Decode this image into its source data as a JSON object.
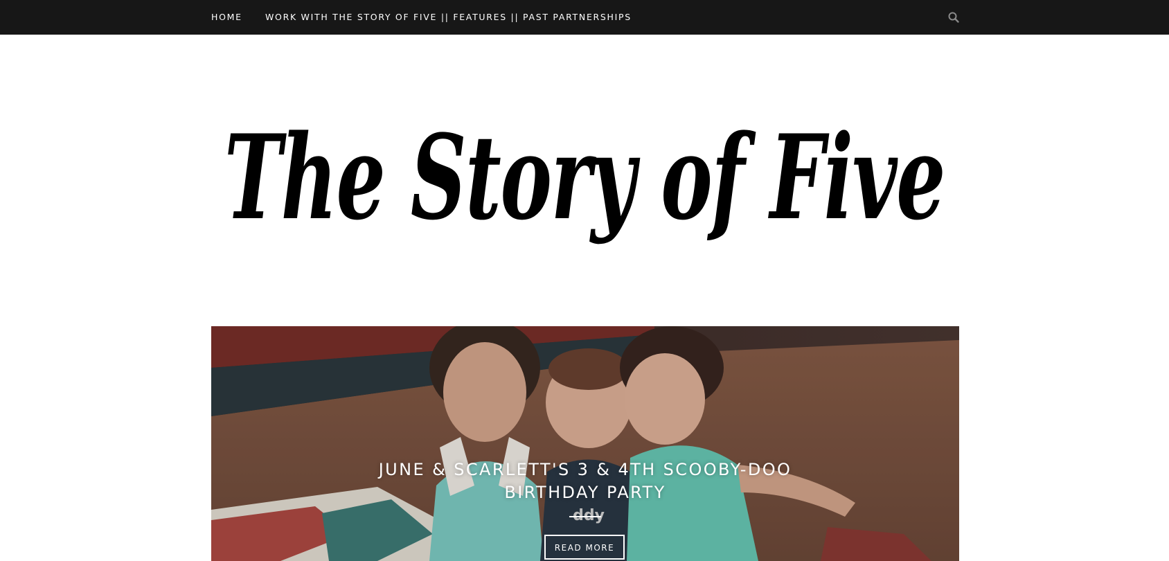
{
  "nav": {
    "home_label": "HOME",
    "work_label": "WORK WITH THE STORY OF FIVE || FEATURES || PAST PARTNERSHIPS",
    "search_icon": "search-icon"
  },
  "logo": {
    "text": "The Story of Five"
  },
  "hero": {
    "title": "JUNE & SCARLETT'S 3 & 4TH SCOOBY-DOO BIRTHDAY PARTY",
    "read_more_label": "READ MORE",
    "shirt_text": "ddy"
  },
  "colors": {
    "nav_bg": "#171717",
    "nav_text": "#ffffff",
    "page_bg": "#ffffff",
    "logo_ink": "#000000"
  }
}
